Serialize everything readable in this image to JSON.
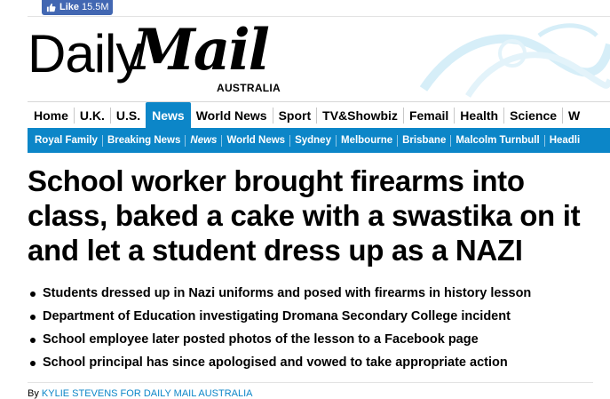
{
  "facebook": {
    "label": "Like",
    "count": "15.5M"
  },
  "logo": {
    "daily": "Daily",
    "mail": "Mail",
    "edition": "AUSTRALIA"
  },
  "nav_primary": [
    {
      "label": "Home",
      "active": false
    },
    {
      "label": "U.K.",
      "active": false
    },
    {
      "label": "U.S.",
      "active": false
    },
    {
      "label": "News",
      "active": true
    },
    {
      "label": "World News",
      "active": false
    },
    {
      "label": "Sport",
      "active": false
    },
    {
      "label": "TV&Showbiz",
      "active": false
    },
    {
      "label": "Femail",
      "active": false
    },
    {
      "label": "Health",
      "active": false
    },
    {
      "label": "Science",
      "active": false
    },
    {
      "label": "W",
      "active": false
    }
  ],
  "nav_secondary": [
    {
      "label": "Royal Family"
    },
    {
      "label": "Breaking News"
    },
    {
      "label": "News"
    },
    {
      "label": "World News"
    },
    {
      "label": "Sydney"
    },
    {
      "label": "Melbourne"
    },
    {
      "label": "Brisbane"
    },
    {
      "label": "Malcolm Turnbull"
    },
    {
      "label": "Headli"
    }
  ],
  "article": {
    "headline": "School worker brought firearms into class, baked a cake with a swastika on it and let a student dress up as a NAZI",
    "bullets": [
      "Students dressed up in Nazi uniforms and posed with firearms in history lesson",
      "Department of Education investigating Dromana Secondary College incident",
      "School employee later posted photos of the lesson to a Facebook page",
      "School principal has since apologised and vowed to take appropriate action"
    ],
    "byline_prefix": "By",
    "byline_author": "KYLIE STEVENS FOR DAILY MAIL AUSTRALIA"
  },
  "colors": {
    "accent": "#0c86c8",
    "facebook": "#4267b2"
  }
}
